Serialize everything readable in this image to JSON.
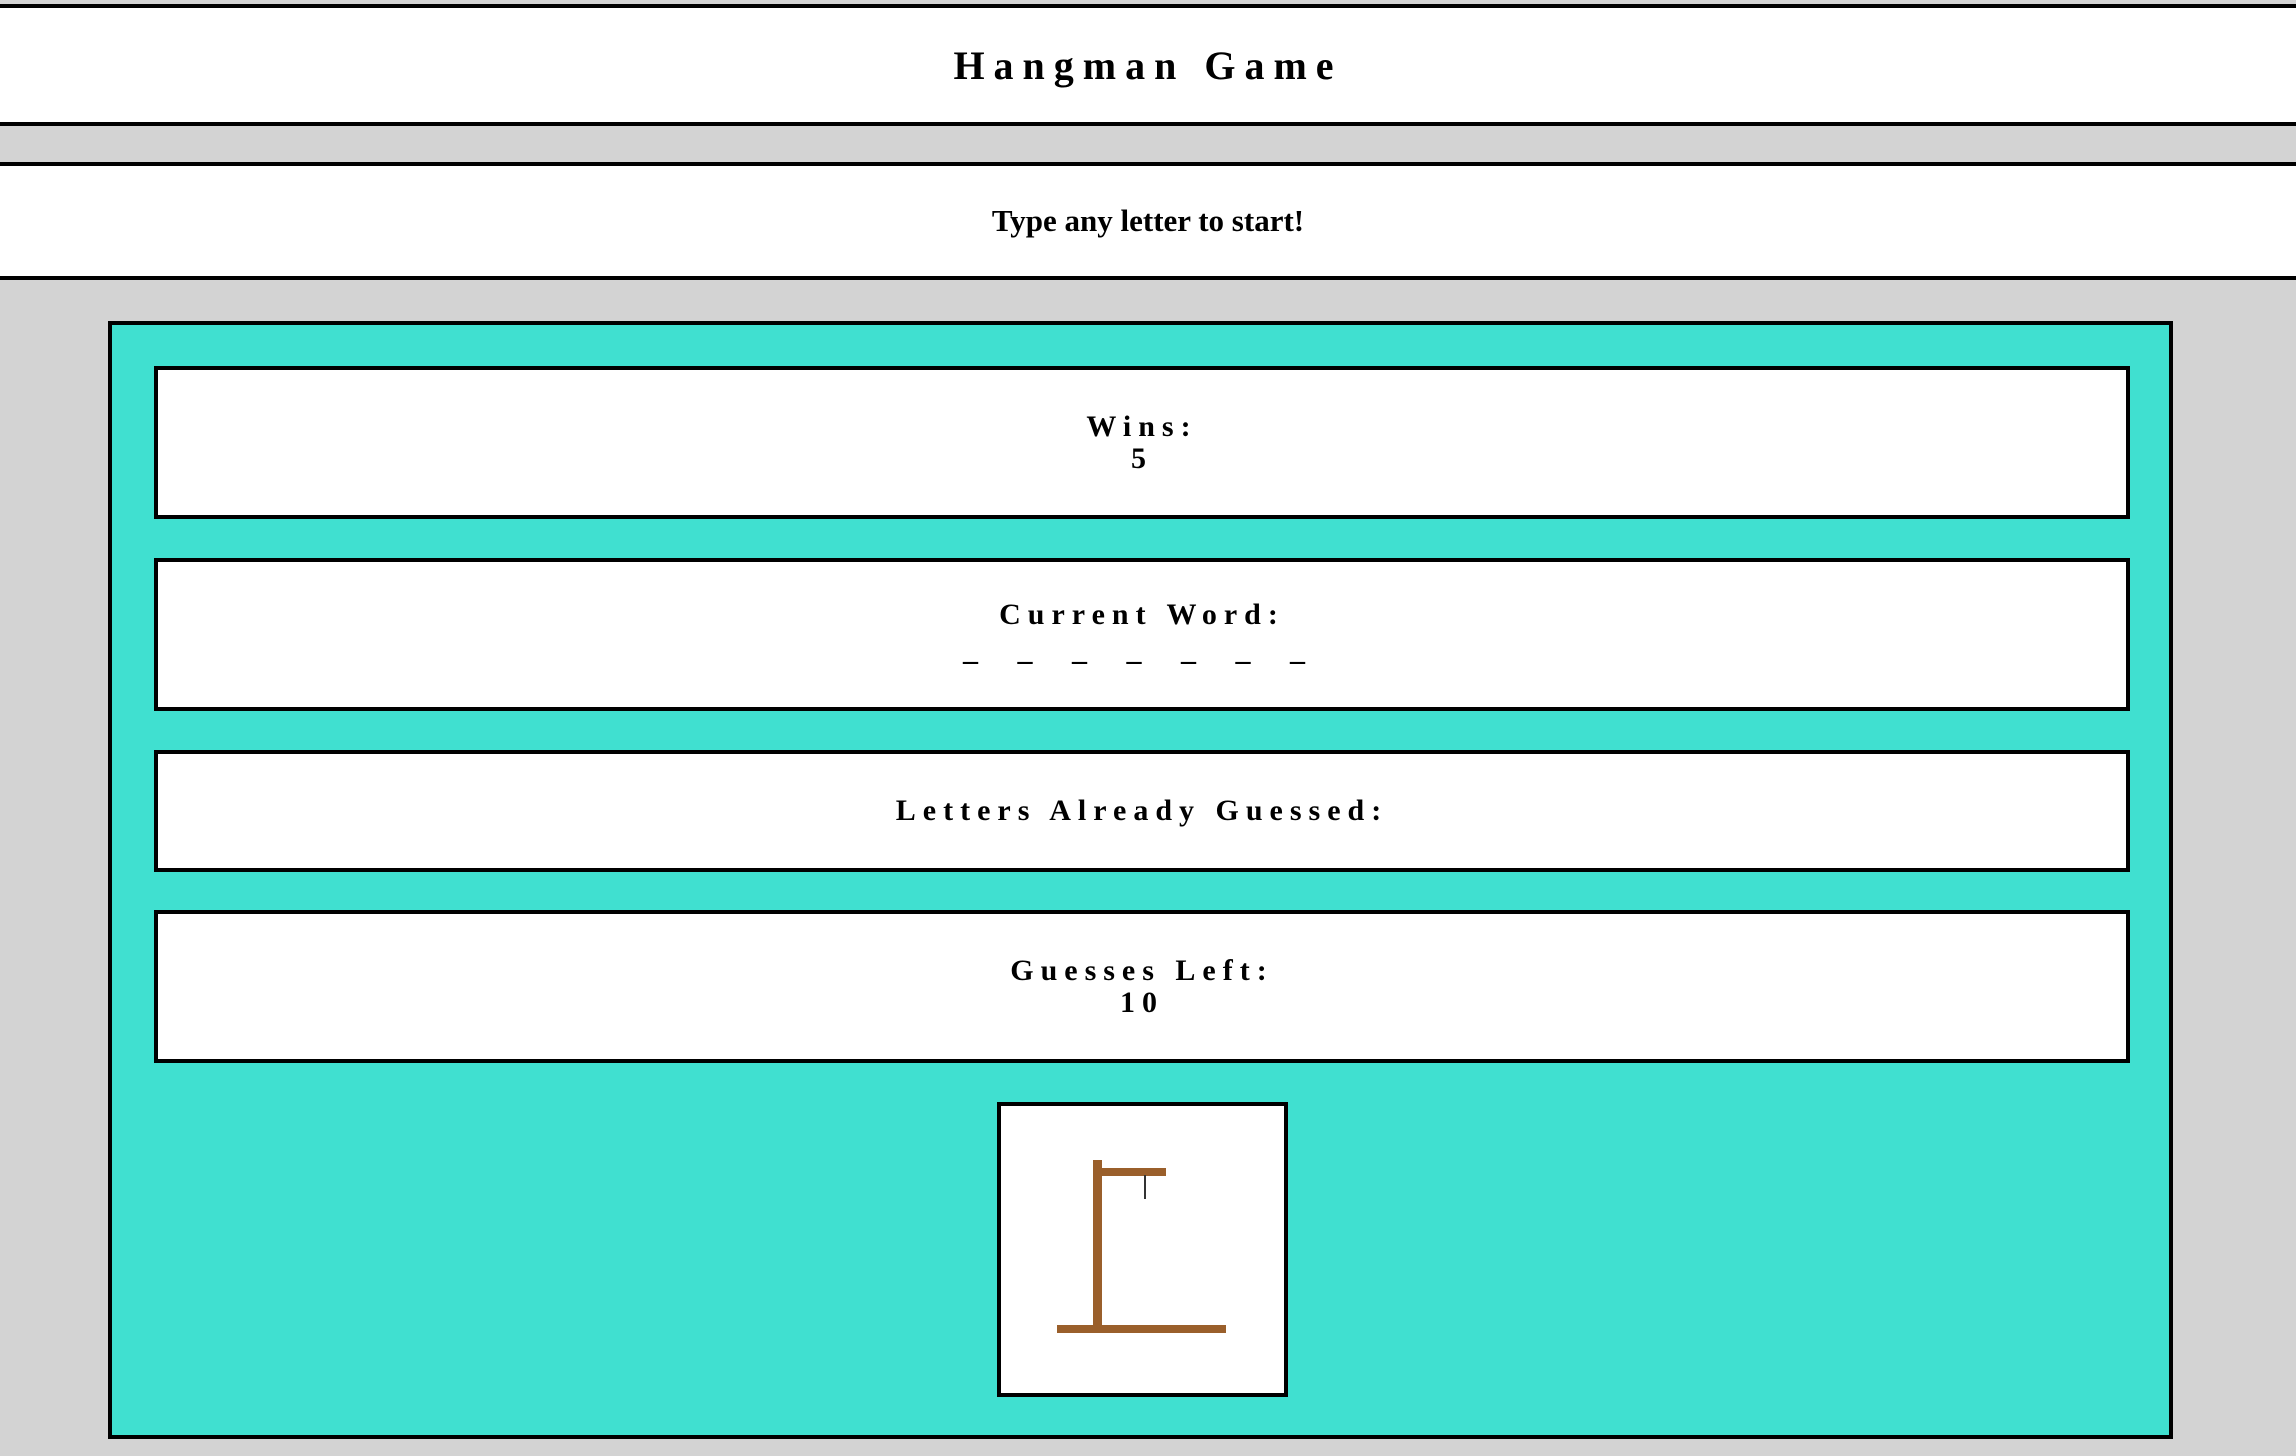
{
  "header": {
    "title": "Hangman Game"
  },
  "status": {
    "message": "Type any letter to start!"
  },
  "stats": {
    "wins_label": "Wins:",
    "wins_value": "5",
    "current_word_label": "Current Word:",
    "current_word_value": "_ _ _ _ _ _ _",
    "guessed_label": "Letters Already Guessed:",
    "guessed_value": "",
    "guesses_left_label": "Guesses Left:",
    "guesses_left_value": "10"
  },
  "hangman": {
    "image": "gallows-icon",
    "gallows_color": "#9a5f2b"
  },
  "colors": {
    "page_background": "#d3d3d3",
    "panel_background": "#40e0d0",
    "box_background": "#ffffff",
    "border": "#000000"
  }
}
